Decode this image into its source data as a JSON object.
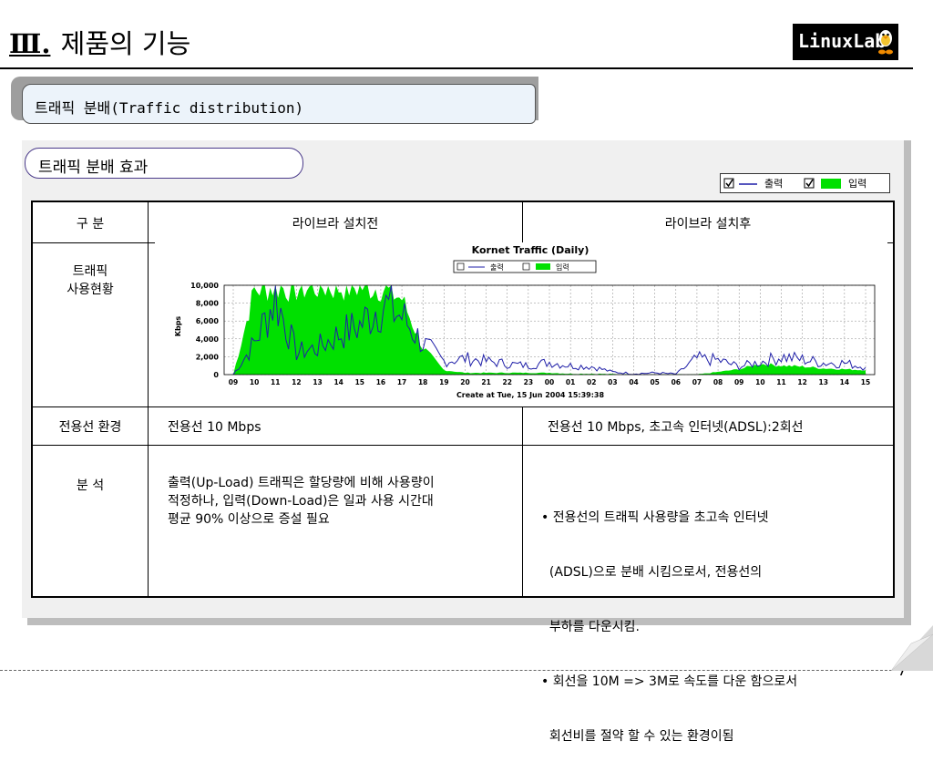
{
  "header": {
    "numeral": "Ⅲ.",
    "title": "제품의 기능",
    "logo_text": "LinuxLab"
  },
  "section": {
    "title": "트래픽 분배(Traffic distribution)"
  },
  "subsection": {
    "title": "트래픽 분배 효과"
  },
  "legend": {
    "out_label": "출력",
    "in_label": "입력",
    "out_color": "#1f1fa8",
    "in_color": "#00e000"
  },
  "table": {
    "headers": [
      "구  분",
      "라이브라 설치전",
      "라이브라 설치후"
    ],
    "row_traffic": {
      "label_line1": "트래픽",
      "label_line2": "사용현황"
    },
    "row_line": {
      "label": "전용선 환경",
      "before": "전용선 10 Mbps",
      "after": "전용선 10 Mbps, 초고속 인터넷(ADSL):2회선"
    },
    "row_analysis": {
      "label": "분  석",
      "before_lines": [
        "출력(Up-Load) 트래픽은 할당량에 비해 사용량이",
        "적정하나, 입력(Down-Load)은 일과 사용 시간대",
        "평균 90% 이상으로 증설 필요"
      ],
      "after_lines": [
        "• 전용선의 트래픽 사용량을 초고속 인터넷",
        "  (ADSL)으로 분배 시킴으로서, 전용선의",
        "  부하를 다운시킴.",
        "• 회선을 10M => 3M로 속도를 다운 함으로서",
        "  회선비를 절약 할 수 있는 환경이됨"
      ]
    }
  },
  "chart_data": {
    "type": "area",
    "title": "Kornet Traffic (Daily)",
    "ylabel": "Kbps",
    "xlabel": "Create at Tue, 15 Jun 2004 15:39:38",
    "ylim": [
      0,
      10000
    ],
    "yticks": [
      "10,000",
      "8,000",
      "6,000",
      "4,000",
      "2,000",
      "0"
    ],
    "x": [
      "09",
      "10",
      "11",
      "12",
      "13",
      "14",
      "15",
      "16",
      "17",
      "18",
      "19",
      "20",
      "21",
      "22",
      "23",
      "00",
      "01",
      "02",
      "03",
      "04",
      "05",
      "06",
      "07",
      "08",
      "09",
      "10",
      "11",
      "12",
      "13",
      "14",
      "15"
    ],
    "series": [
      {
        "name": "입력",
        "values": [
          0,
          9500,
          9800,
          9600,
          9800,
          9700,
          9800,
          9700,
          8500,
          3000,
          500,
          200,
          200,
          200,
          200,
          200,
          100,
          100,
          50,
          0,
          0,
          0,
          0,
          300,
          600,
          1200,
          1000,
          900,
          700,
          600,
          500
        ]
      },
      {
        "name": "출력",
        "values": [
          0,
          3500,
          8600,
          2500,
          3000,
          4500,
          5500,
          8000,
          6500,
          3500,
          1500,
          1800,
          1500,
          1200,
          1000,
          1400,
          1000,
          900,
          300,
          100,
          200,
          50,
          1800,
          1600,
          900,
          1400,
          2000,
          1700,
          1300,
          1300,
          800
        ]
      }
    ],
    "legend": [
      "출력",
      "입력"
    ]
  },
  "page": {
    "number": "7"
  }
}
